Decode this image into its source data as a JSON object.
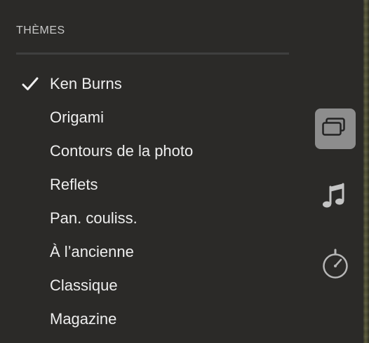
{
  "section": {
    "title": "THÈMES"
  },
  "themes": {
    "selected_index": 0,
    "items": [
      {
        "label": "Ken Burns",
        "checked": true
      },
      {
        "label": "Origami",
        "checked": false
      },
      {
        "label": "Contours de la photo",
        "checked": false
      },
      {
        "label": "Reflets",
        "checked": false
      },
      {
        "label": "Pan. couliss.",
        "checked": false
      },
      {
        "label": "À l’ancienne",
        "checked": false
      },
      {
        "label": "Classique",
        "checked": false
      },
      {
        "label": "Magazine",
        "checked": false
      }
    ]
  },
  "sidebar_tools": [
    {
      "icon": "themes-icon",
      "selected": true
    },
    {
      "icon": "music-note-icon",
      "selected": false
    },
    {
      "icon": "stopwatch-icon",
      "selected": false
    }
  ],
  "colors": {
    "background": "#2b2a28",
    "text": "#eeeeee",
    "section_title": "#c8c8c8",
    "selected_tool_bg": "#8d8d8d"
  }
}
